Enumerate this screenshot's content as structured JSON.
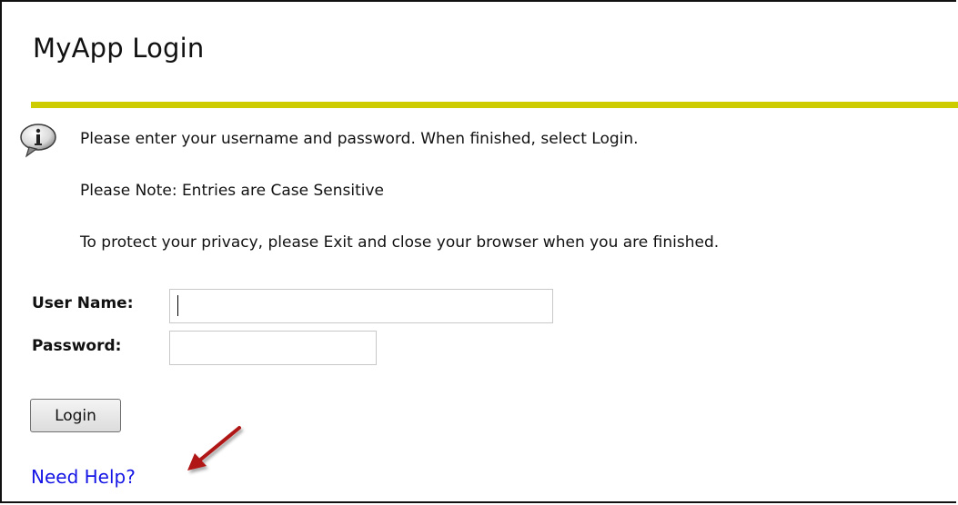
{
  "page": {
    "title": "MyApp Login",
    "accent_color": "#cccc00",
    "link_color": "#1515e6"
  },
  "info": {
    "icon": "info-speech-bubble-icon",
    "instruction": "Please enter your username and password. When finished, select Login.",
    "note": "Please Note: Entries are Case Sensitive",
    "privacy": "To protect your privacy, please Exit and close your browser when you are finished."
  },
  "form": {
    "username_label": "User Name:",
    "username_value": "",
    "password_label": "Password:",
    "password_value": "",
    "login_label": "Login"
  },
  "help": {
    "link_text": "Need Help?",
    "annotation_icon": "red-arrow-pointer-icon",
    "annotation_color": "#b01818"
  }
}
